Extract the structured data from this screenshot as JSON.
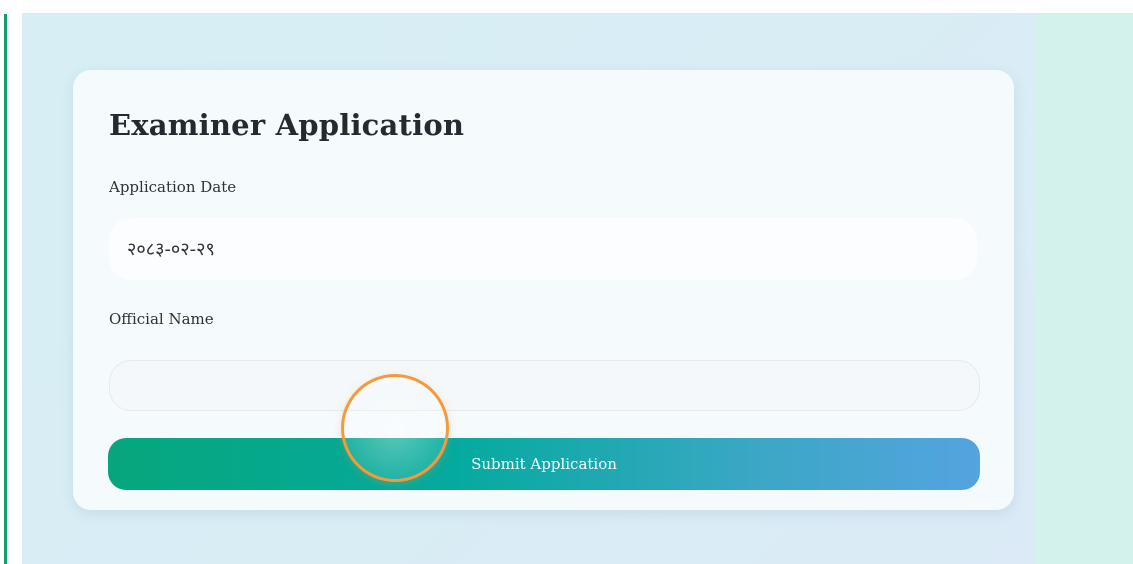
{
  "form": {
    "title": "Examiner Application",
    "date_label": "Application Date",
    "date_value": "२०८३-०२-२९",
    "name_label": "Official Name",
    "name_value": "",
    "submit_label": "Submit Application"
  },
  "colors": {
    "accent_green": "#06a67c",
    "accent_blue": "#54a4df",
    "cursor_ring": "#f39a3c",
    "left_rule": "#0f9e70"
  }
}
